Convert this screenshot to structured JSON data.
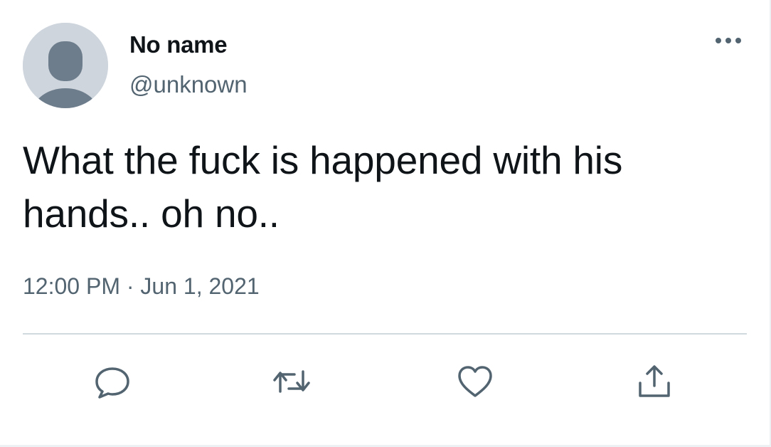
{
  "tweet": {
    "author": {
      "display_name": "No name",
      "handle": "@unknown",
      "avatar_icon": "default-avatar-icon"
    },
    "text_lines": [
      "What the fuck is happened with his",
      "hands.. oh no.."
    ],
    "time": "12:00 PM",
    "separator": "·",
    "date": "Jun 1, 2021"
  },
  "actions": [
    {
      "name": "reply",
      "icon": "comment-bubble-icon"
    },
    {
      "name": "retweet",
      "icon": "retweet-arrows-icon"
    },
    {
      "name": "like",
      "icon": "heart-icon"
    },
    {
      "name": "share",
      "icon": "share-upload-icon"
    }
  ],
  "menu": {
    "icon": "more-dots-icon"
  },
  "colors": {
    "primary_text": "#0f1419",
    "secondary_text": "#536471",
    "avatar_bg": "#ced5dc",
    "avatar_fg": "#6e7d8c",
    "divider": "#cfd9de"
  }
}
